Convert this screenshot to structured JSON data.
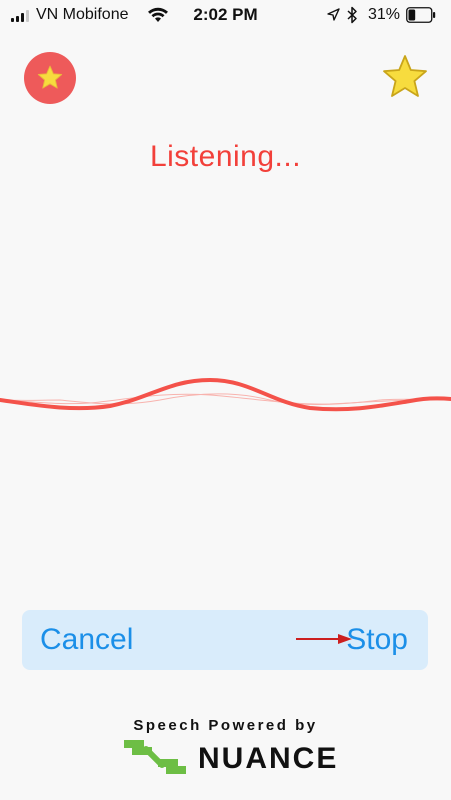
{
  "status_bar": {
    "carrier": "VN Mobifone",
    "time": "2:02 PM",
    "battery_percent": "31%",
    "battery_level": 0.31,
    "icons": [
      "signal-icon",
      "wifi-icon",
      "location-icon",
      "bluetooth-icon",
      "battery-icon"
    ]
  },
  "header": {
    "favorites_icon": "star-icon",
    "star_icon": "star-icon"
  },
  "main": {
    "status_text": "Listening..."
  },
  "actions": {
    "cancel_label": "Cancel",
    "stop_label": "Stop"
  },
  "footer": {
    "powered_by": "Speech Powered by",
    "brand": "NUANCE"
  },
  "colors": {
    "accent_red": "#f2403a",
    "wave_red": "#f4524a",
    "button_blue": "#1b8fe8",
    "bar_bg": "#d9ecfb",
    "star_yellow": "#f7dc3e",
    "nuance_green": "#6dbe45"
  }
}
